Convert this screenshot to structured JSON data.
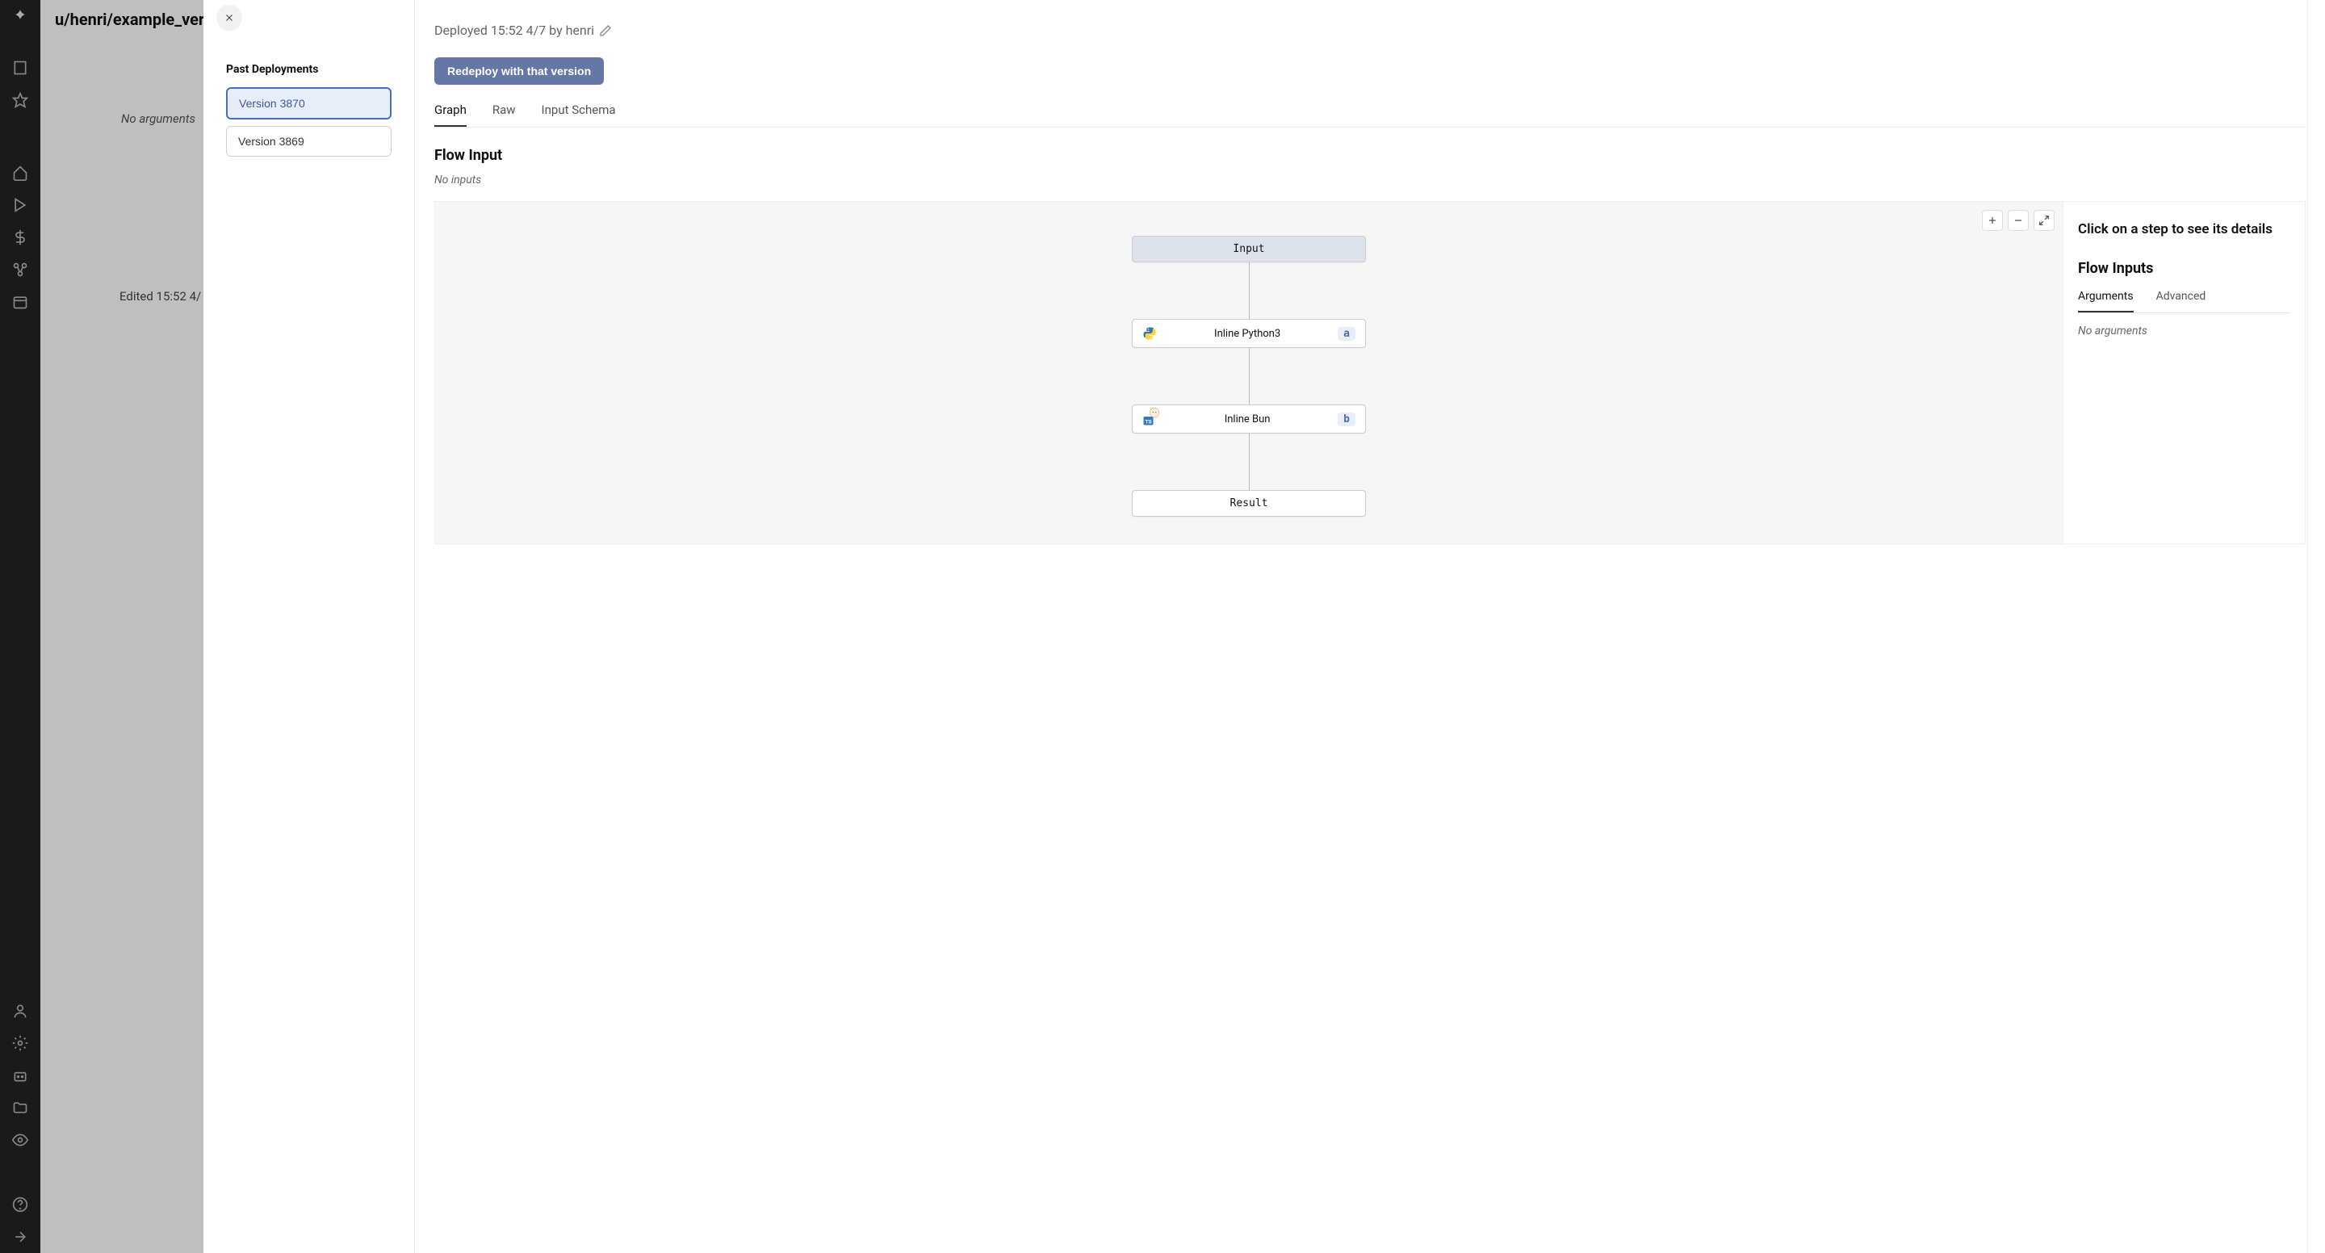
{
  "breadcrumb": "u/henri/example_ver",
  "bg": {
    "no_arguments": "No arguments",
    "edited": "Edited 15:52 4/"
  },
  "sidebar_panel": {
    "title": "Past Deployments",
    "versions": [
      "Version 3870",
      "Version 3869"
    ]
  },
  "detail": {
    "deployed_text": "Deployed 15:52 4/7 by henri",
    "redeploy_btn": "Redeploy with that version",
    "tabs": [
      "Graph",
      "Raw",
      "Input Schema"
    ],
    "flow_input_title": "Flow Input",
    "no_inputs": "No inputs",
    "flow_nodes": {
      "input": "Input",
      "step_a_label": "Inline Python3",
      "step_a_badge": "a",
      "step_b_label": "Inline Bun",
      "step_b_badge": "b",
      "result": "Result"
    },
    "side_panel": {
      "title": "Click on a step to see its details",
      "inputs_title": "Flow Inputs",
      "tabs": [
        "Arguments",
        "Advanced"
      ],
      "no_args": "No arguments"
    }
  }
}
